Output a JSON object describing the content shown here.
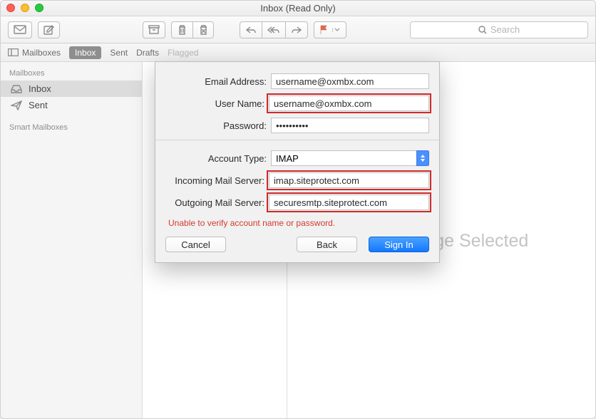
{
  "window": {
    "title": "Inbox (Read Only)"
  },
  "toolbar": {
    "search_placeholder": "Search"
  },
  "favbar": {
    "mailboxes": "Mailboxes",
    "inbox": "Inbox",
    "sent": "Sent",
    "drafts": "Drafts",
    "flagged": "Flagged"
  },
  "sidebar": {
    "heading1": "Mailboxes",
    "items": [
      {
        "label": "Inbox",
        "icon": "inbox"
      },
      {
        "label": "Sent",
        "icon": "sent"
      }
    ],
    "heading2": "Smart Mailboxes"
  },
  "detail": {
    "placeholder": "No Message Selected"
  },
  "sheet": {
    "labels": {
      "email": "Email Address:",
      "username": "User Name:",
      "password": "Password:",
      "account_type": "Account Type:",
      "incoming": "Incoming Mail Server:",
      "outgoing": "Outgoing Mail Server:"
    },
    "values": {
      "email": "username@oxmbx.com",
      "username": "username@oxmbx.com",
      "password": "••••••••••",
      "account_type": "IMAP",
      "incoming": "imap.siteprotect.com",
      "outgoing": "securesmtp.siteprotect.com"
    },
    "error": "Unable to verify account name or password.",
    "buttons": {
      "cancel": "Cancel",
      "back": "Back",
      "signin": "Sign In"
    }
  }
}
